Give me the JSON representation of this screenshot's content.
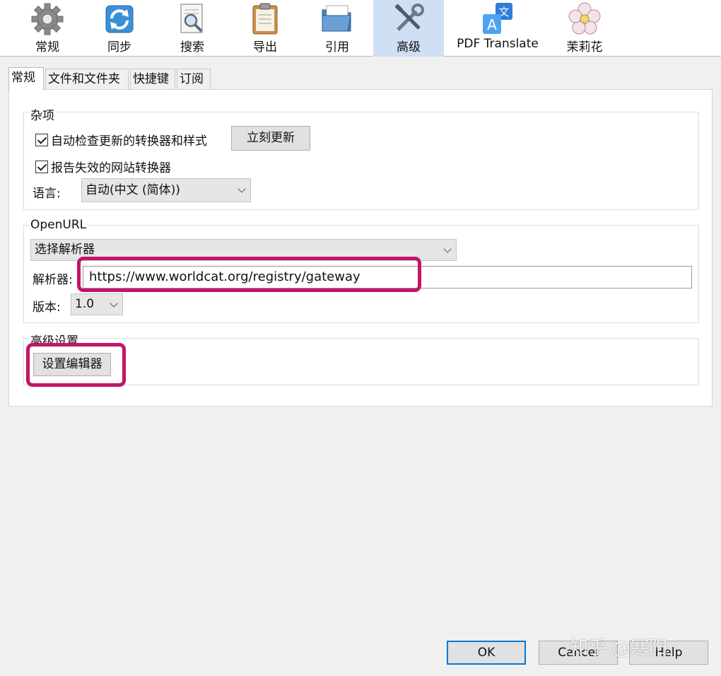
{
  "toolbar": {
    "items": [
      {
        "label": "常规"
      },
      {
        "label": "同步"
      },
      {
        "label": "搜索"
      },
      {
        "label": "导出"
      },
      {
        "label": "引用"
      },
      {
        "label": "高级"
      },
      {
        "label": "PDF Translate"
      },
      {
        "label": "茉莉花"
      }
    ],
    "active": "高级"
  },
  "tabs": [
    "常规",
    "文件和文件夹",
    "快捷键",
    "订阅"
  ],
  "misc": {
    "title": "杂项",
    "auto_update_label": "自动检查更新的转换器和样式",
    "auto_update_checked": true,
    "update_now_button": "立刻更新",
    "report_label": "报告失效的网站转换器",
    "report_checked": true,
    "language_label": "语言:",
    "language_value": "自动(中文 (简体))"
  },
  "openurl": {
    "title": "OpenURL",
    "resolver_select": "选择解析器",
    "resolver_label": "解析器:",
    "resolver_value": "https://www.worldcat.org/registry/gateway",
    "version_label": "版本:",
    "version_value": "1.0"
  },
  "advanced": {
    "title": "高级设置",
    "config_editor_button": "设置编辑器"
  },
  "footer": {
    "ok": "OK",
    "cancel": "Cancel",
    "help": "Help",
    "watermark": "知乎 @寒阳"
  },
  "colors": {
    "highlight": "#c2156b",
    "active_tab_bg": "#cfdff4"
  }
}
